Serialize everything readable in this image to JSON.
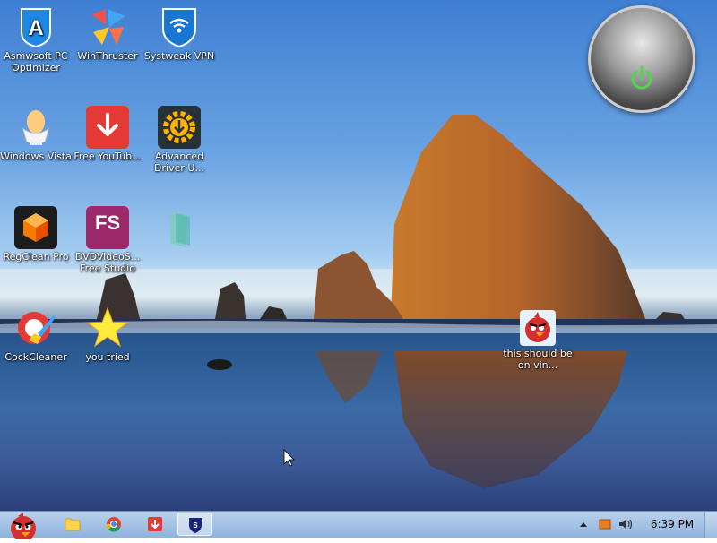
{
  "desktop_icons": [
    {
      "label": "Asmwsoft PC Optimizer"
    },
    {
      "label": "WinThruster"
    },
    {
      "label": "Systweak VPN"
    },
    {
      "label": "Windows Vista"
    },
    {
      "label": "Free YouTub..."
    },
    {
      "label": "Advanced Driver U..."
    },
    {
      "label": "RegClean Pro"
    },
    {
      "label": "DVDVideoS... Free Studio"
    },
    {
      "label": ""
    },
    {
      "label": "CockCleaner"
    },
    {
      "label": "you tried"
    },
    {
      "label": "this should be on vin..."
    }
  ],
  "fs_logo_text": "FS",
  "taskbar": {
    "clock": "6:39 PM"
  },
  "colors": {
    "taskbar": "#a6c4e6",
    "power_green": "#52d64a",
    "youtube_red": "#e53935",
    "fs_purple": "#9c2a6b"
  }
}
